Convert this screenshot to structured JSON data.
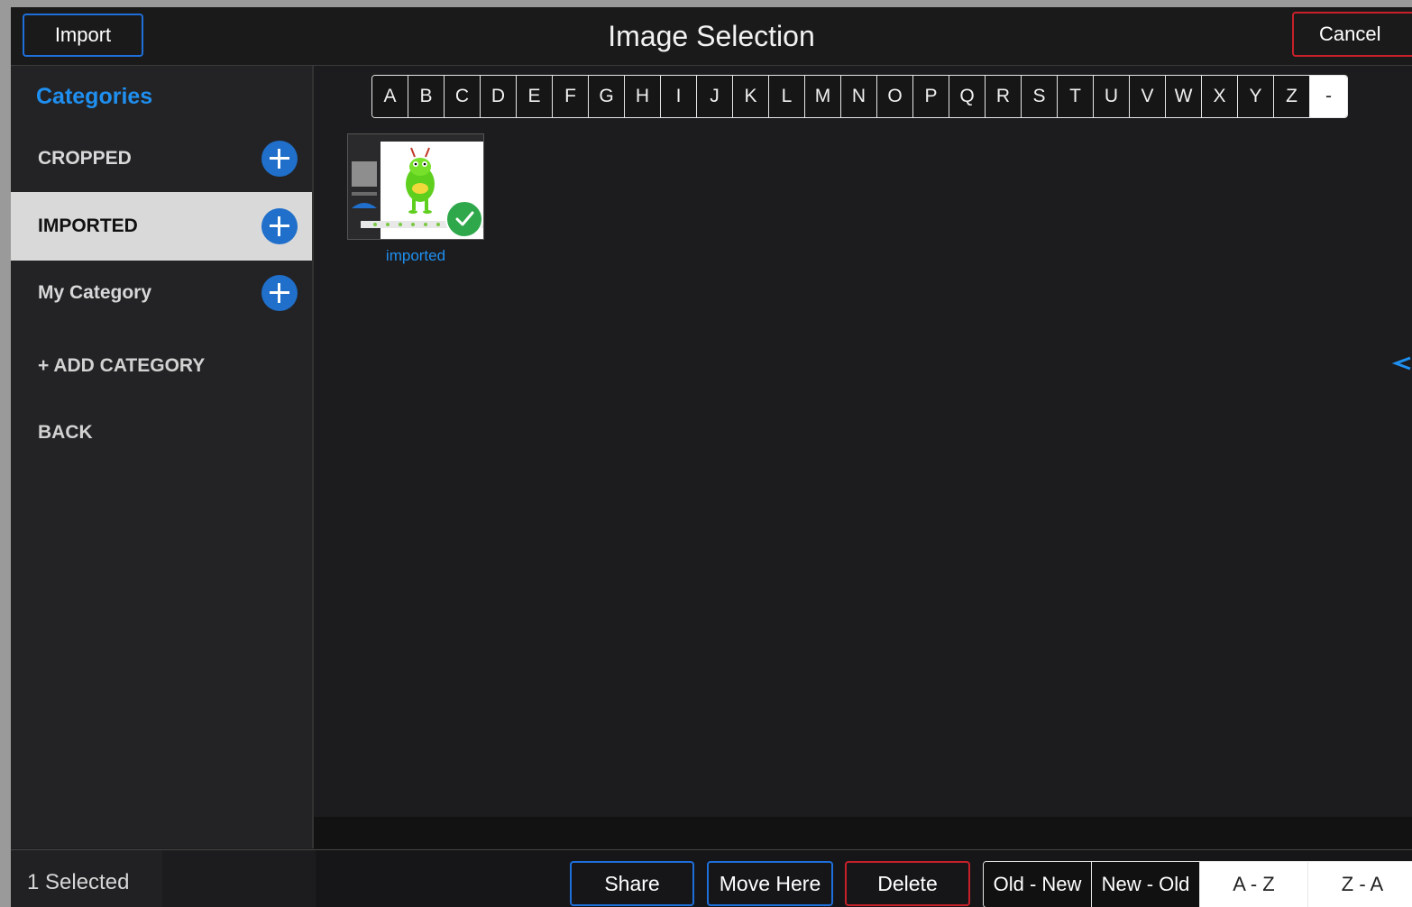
{
  "header": {
    "title": "Image Selection",
    "import_label": "Import",
    "cancel_label": "Cancel"
  },
  "sidebar": {
    "title": "Categories",
    "categories": [
      {
        "label": "CROPPED",
        "selected": false
      },
      {
        "label": "IMPORTED",
        "selected": true
      },
      {
        "label": "My Category",
        "selected": false
      }
    ],
    "add_category_label": "+ ADD CATEGORY",
    "back_label": "BACK"
  },
  "alphabet": [
    "A",
    "B",
    "C",
    "D",
    "E",
    "F",
    "G",
    "H",
    "I",
    "J",
    "K",
    "L",
    "M",
    "N",
    "O",
    "P",
    "Q",
    "R",
    "S",
    "T",
    "U",
    "V",
    "W",
    "X",
    "Y",
    "Z",
    "-"
  ],
  "images": [
    {
      "label": "imported",
      "selected": true
    }
  ],
  "footer": {
    "selected_text": "1 Selected",
    "share_label": "Share",
    "move_here_label": "Move Here",
    "delete_label": "Delete",
    "sort_options": [
      {
        "label": "Old - New",
        "active": false
      },
      {
        "label": "New - Old",
        "active": false
      },
      {
        "label": "A - Z",
        "active": true
      },
      {
        "label": "Z - A",
        "active": true
      }
    ]
  },
  "colors": {
    "accent_blue": "#1f8ff0",
    "button_blue": "#1e6fd9",
    "danger_red": "#c8202a",
    "check_green": "#2ea84a",
    "background": "#1c1c1e"
  }
}
